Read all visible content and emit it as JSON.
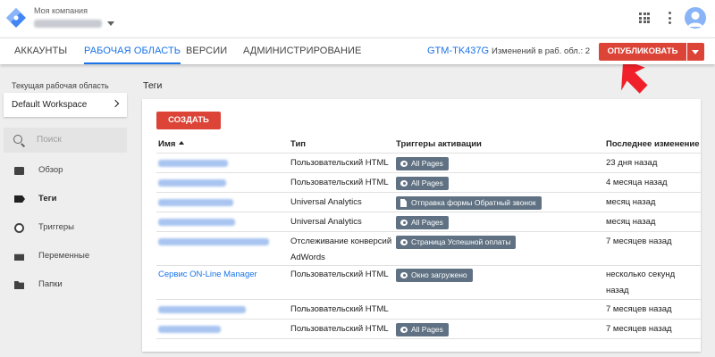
{
  "header": {
    "account_title": "Моя компания"
  },
  "nav": {
    "tabs": [
      "АККАУНТЫ",
      "РАБОЧАЯ ОБЛАСТЬ",
      "ВЕРСИИ",
      "АДМИНИСТРИРОВАНИЕ"
    ],
    "active_tab": "РАБОЧАЯ ОБЛАСТЬ",
    "container_id": "GTM-TK437G",
    "changes_text": "Изменений в раб. обл.: 2",
    "publish_label": "ОПУБЛИКОВАТЬ"
  },
  "sidebar": {
    "workspace_label": "Текущая рабочая область",
    "workspace_name": "Default Workspace",
    "search_placeholder": "Поиск",
    "items": [
      {
        "label": "Обзор",
        "icon": "overview-icon"
      },
      {
        "label": "Теги",
        "icon": "tag-icon",
        "active": true
      },
      {
        "label": "Триггеры",
        "icon": "trigger-icon"
      },
      {
        "label": "Переменные",
        "icon": "variables-icon"
      },
      {
        "label": "Папки",
        "icon": "folder-icon"
      }
    ]
  },
  "main": {
    "section_title": "Теги",
    "create_label": "СОЗДАТЬ",
    "columns": [
      "Имя",
      "Тип",
      "Триггеры активации",
      "Последнее изменение"
    ],
    "rows": [
      {
        "name": "",
        "type": "Пользовательский HTML",
        "trigger": "All Pages",
        "trigger_icon": "eye-icon",
        "modified": "23 дня назад"
      },
      {
        "name": "",
        "type": "Пользовательский HTML",
        "trigger": "All Pages",
        "trigger_icon": "eye-icon",
        "modified": "4 месяца назад"
      },
      {
        "name": "",
        "type": "Universal Analytics",
        "trigger": "Отправка формы Обратный звонок",
        "trigger_icon": "form-icon",
        "modified": "месяц назад"
      },
      {
        "name": "",
        "type": "Universal Analytics",
        "trigger": "All Pages",
        "trigger_icon": "eye-icon",
        "modified": "месяц назад"
      },
      {
        "name": "",
        "type": "Отслеживание конверсий AdWords",
        "trigger": "Страница Успешной оплаты",
        "trigger_icon": "eye-icon",
        "modified": "7 месяцев назад"
      },
      {
        "name": "Сервис ON-Line Manager",
        "type": "Пользовательский HTML",
        "trigger": "Окно загружено",
        "trigger_icon": "eye-icon",
        "modified": "несколько секунд назад"
      },
      {
        "name": "",
        "type": "Пользовательский HTML",
        "trigger": "",
        "trigger_icon": "",
        "modified": "7 месяцев назад"
      },
      {
        "name": "",
        "type": "Пользовательский HTML",
        "trigger": "All Pages",
        "trigger_icon": "eye-icon",
        "modified": "7 месяцев назад"
      }
    ]
  },
  "colors": {
    "accent_blue": "#1a73e8",
    "publish_red": "#db4437",
    "chip_gray": "#5f7182",
    "pointer_red": "#f0202a"
  }
}
